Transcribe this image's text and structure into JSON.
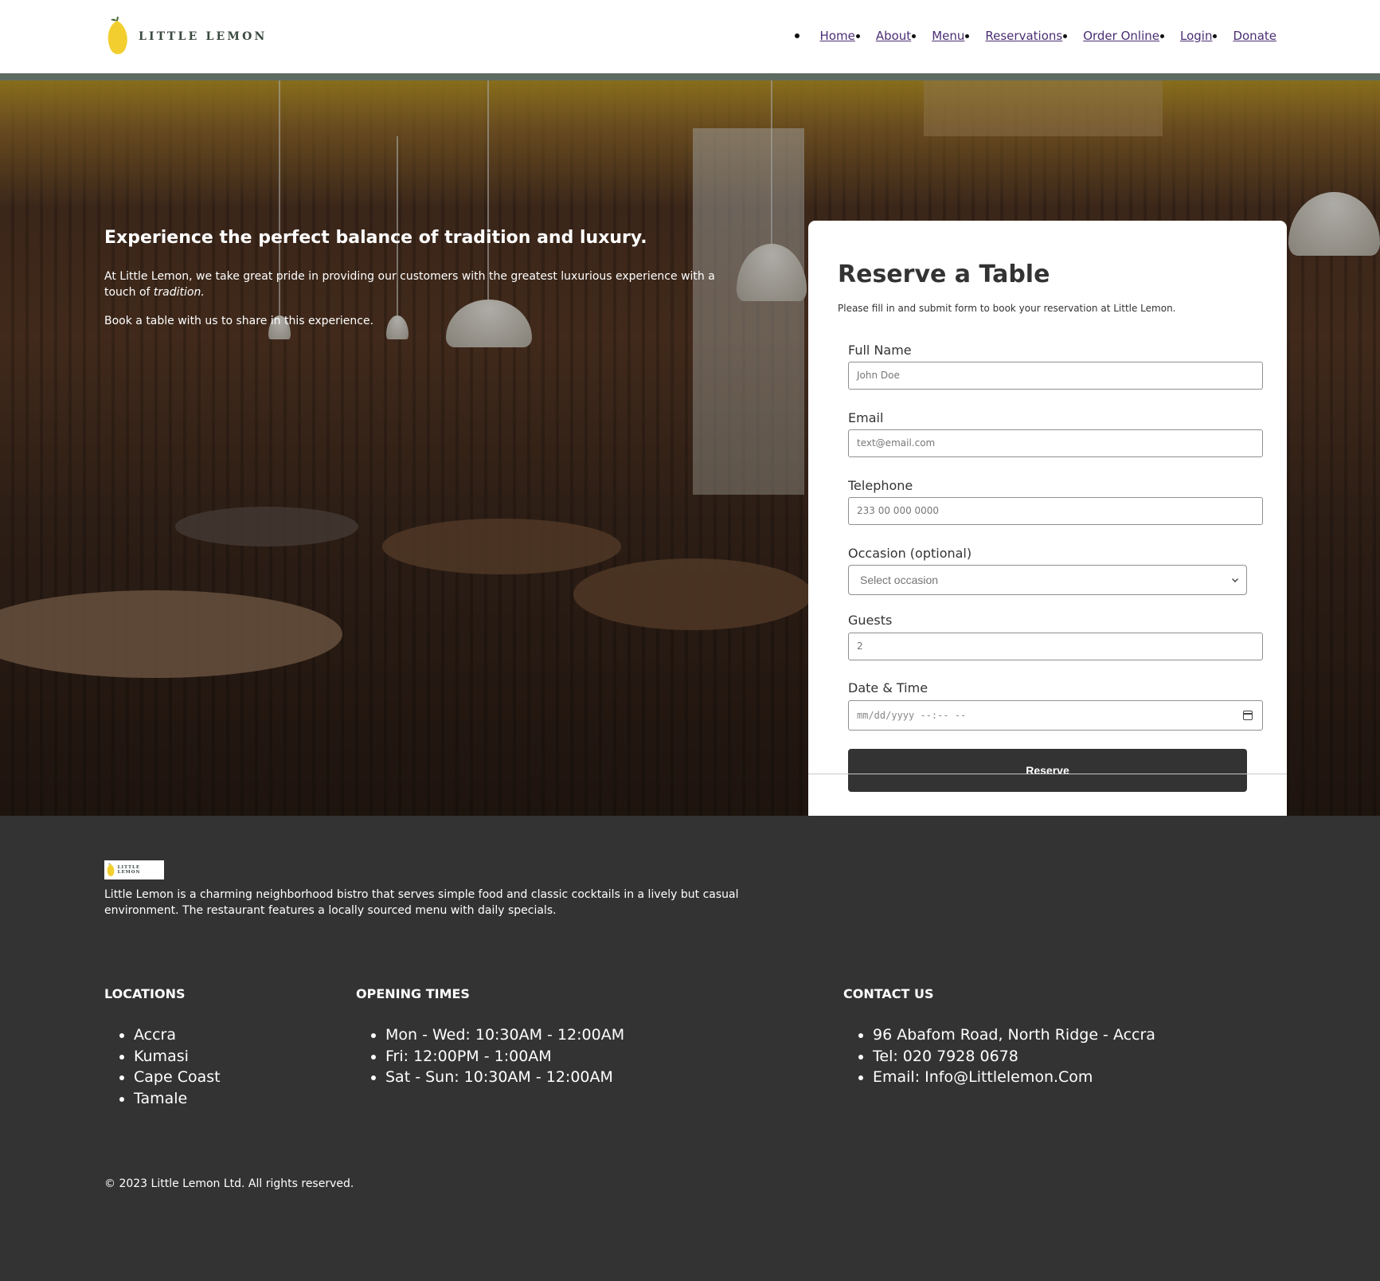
{
  "brand": {
    "name": "LITTLE LEMON"
  },
  "nav": {
    "items": [
      {
        "label": "Home"
      },
      {
        "label": "About"
      },
      {
        "label": "Menu"
      },
      {
        "label": "Reservations"
      },
      {
        "label": "Order Online"
      },
      {
        "label": "Login"
      },
      {
        "label": "Donate"
      }
    ]
  },
  "hero": {
    "title": "Experience the perfect balance of tradition and luxury.",
    "paragraph1_start": "At Little Lemon, we take great pride in providing our customers with the greatest luxurious experience with a touch of ",
    "paragraph1_emphasis": "tradition.",
    "paragraph2": "Book a table with us to share in this experience."
  },
  "form": {
    "title": "Reserve a Table",
    "subtitle": "Please fill in and submit form to book your reservation at Little Lemon.",
    "full_name": {
      "label": "Full Name",
      "placeholder": "John Doe"
    },
    "email": {
      "label": "Email",
      "placeholder": "text@email.com"
    },
    "telephone": {
      "label": "Telephone",
      "placeholder": "233 00 000 0000"
    },
    "occasion": {
      "label": "Occasion (optional)",
      "selected": "Select occasion"
    },
    "guests": {
      "label": "Guests",
      "value": "2"
    },
    "datetime": {
      "label": "Date & Time",
      "placeholder": "mm/dd/yyyy --:-- --"
    },
    "submit_label": "Reserve"
  },
  "footer": {
    "logo_text": "LITTLE LEMON",
    "description": "Little Lemon is a charming neighborhood bistro that serves simple food and classic cocktails in a lively but casual environment. The restaurant features a locally sourced menu with daily specials.",
    "locations": {
      "title": "LOCATIONS",
      "items": [
        "Accra",
        "Kumasi",
        "Cape Coast",
        "Tamale"
      ]
    },
    "opening_times": {
      "title": "OPENING TIMES",
      "items": [
        "Mon - Wed: 10:30AM - 12:00AM",
        "Fri: 12:00PM - 1:00AM",
        "Sat - Sun: 10:30AM - 12:00AM"
      ]
    },
    "contact": {
      "title": "CONTACT US",
      "items": [
        "96 Abafom Road, North Ridge - Accra",
        "Tel: 020 7928 0678",
        "Email: Info@Littlelemon.Com"
      ]
    },
    "copyright": "© 2023 Little Lemon Ltd. All rights reserved."
  },
  "colors": {
    "header_bg": "#ffffff",
    "header_stripe": "#5e6b62",
    "nav_link": "#4a2e73",
    "footer_bg": "#333333",
    "button_bg": "#333333",
    "lemon": "#f4d23c"
  }
}
